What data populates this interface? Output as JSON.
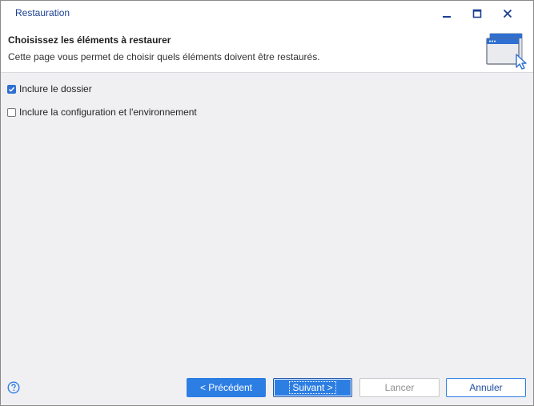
{
  "window": {
    "title": "Restauration",
    "controls": {
      "minimize_icon": "minimize-icon",
      "maximize_icon": "maximize-icon",
      "close_icon": "close-icon"
    }
  },
  "header": {
    "title": "Choisissez les éléments à restaurer",
    "description": "Cette page vous permet de choisir quels éléments doivent être restaurés.",
    "icon": "window-cursor-icon"
  },
  "options": [
    {
      "label": "Inclure le dossier",
      "checked": true
    },
    {
      "label": "Inclure la configuration et l'environnement",
      "checked": false
    }
  ],
  "footer": {
    "help_icon": "help-icon",
    "buttons": {
      "previous": "< Précédent",
      "next": "Suivant >",
      "launch": "Lancer",
      "cancel": "Annuler"
    }
  },
  "colors": {
    "accent": "#2d7ee3",
    "title_text": "#1c3f94",
    "background": "#f0f0f3"
  }
}
